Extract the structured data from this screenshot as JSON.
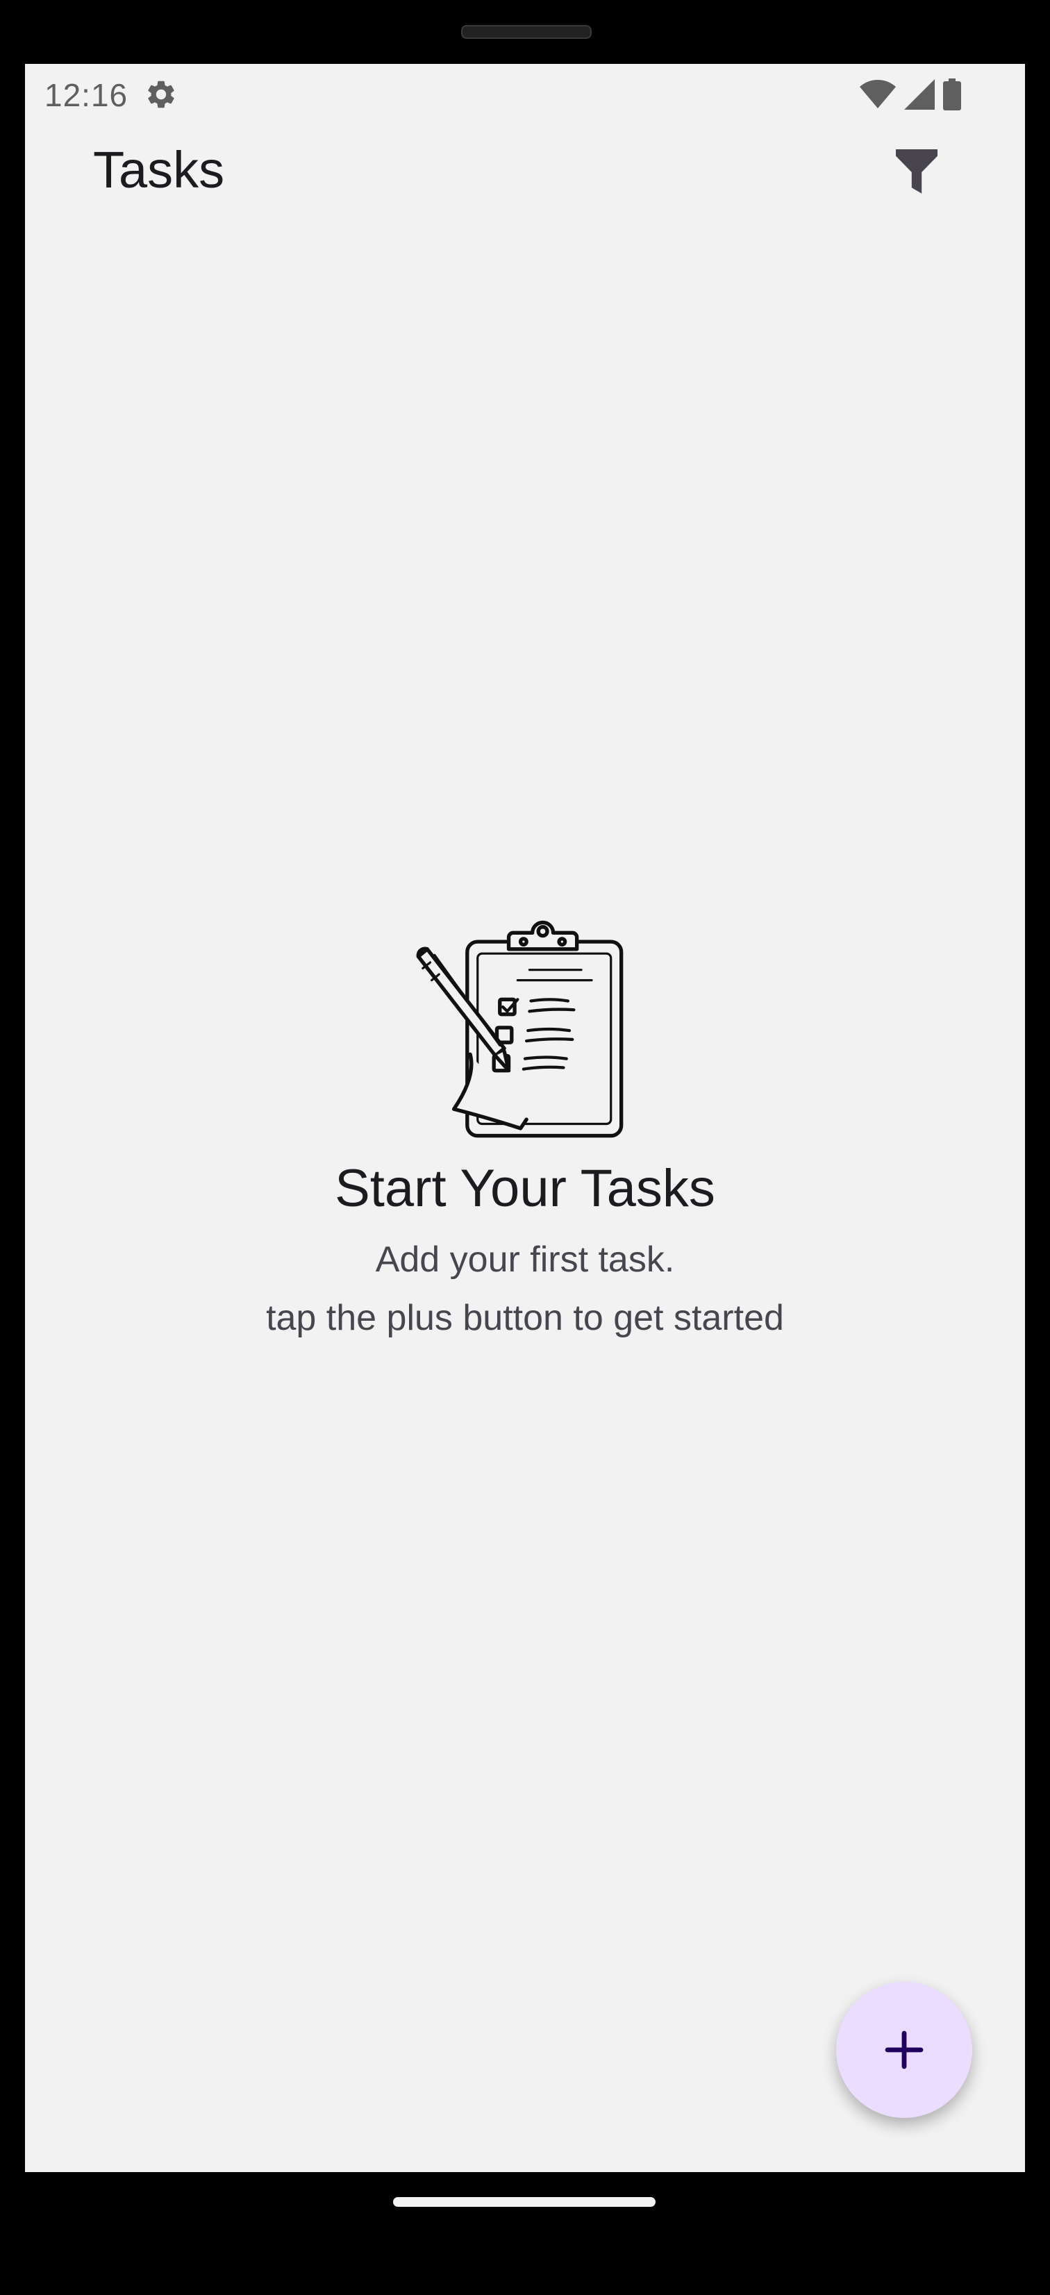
{
  "status_bar": {
    "time": "12:16",
    "icons": [
      "gear-icon",
      "wifi-icon",
      "signal-icon",
      "battery-icon"
    ]
  },
  "app_bar": {
    "title": "Tasks",
    "filter_icon": "filter-icon"
  },
  "empty_state": {
    "illustration": "clipboard-checklist-icon",
    "title": "Start Your Tasks",
    "subtitle_line1": "Add your first task.",
    "subtitle_line2": "tap the plus button to get started"
  },
  "fab": {
    "icon": "plus-icon",
    "color": "#eaddff",
    "icon_color": "#21005d"
  },
  "colors": {
    "background": "#f2f2f2",
    "text_primary": "#1c1b1f",
    "text_secondary": "#49454f"
  }
}
